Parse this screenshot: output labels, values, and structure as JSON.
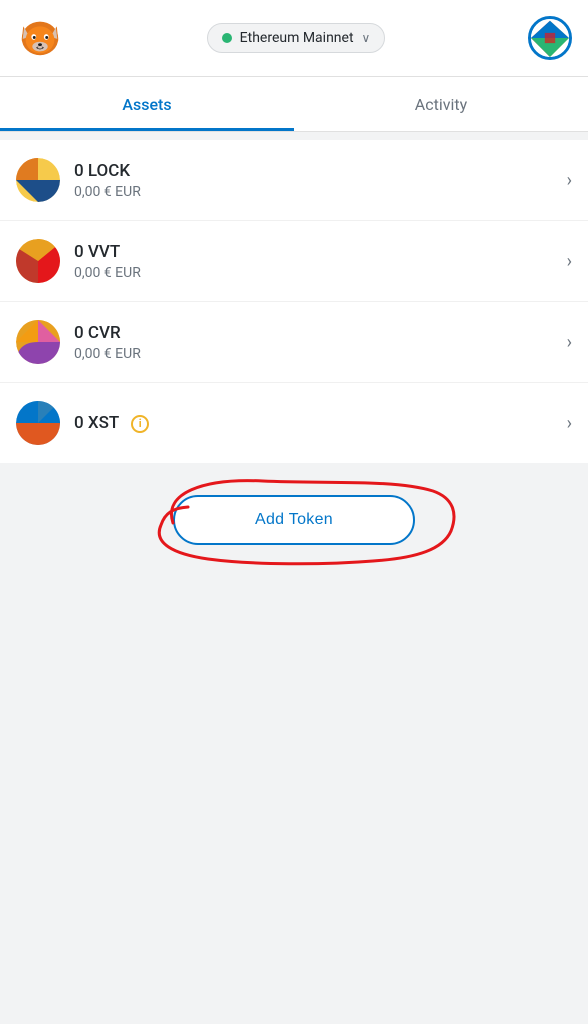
{
  "header": {
    "network_name": "Ethereum Mainnet",
    "network_dot_color": "#29b573"
  },
  "tabs": {
    "assets_label": "Assets",
    "activity_label": "Activity",
    "active": "assets"
  },
  "tokens": [
    {
      "id": "lock",
      "name": "0 LOCK",
      "value": "0,00 € EUR",
      "has_info": false
    },
    {
      "id": "vvt",
      "name": "0 VVT",
      "value": "0,00 € EUR",
      "has_info": false
    },
    {
      "id": "cvr",
      "name": "0 CVR",
      "value": "0,00 € EUR",
      "has_info": false
    },
    {
      "id": "xst",
      "name": "0 XST",
      "value": "",
      "has_info": true
    }
  ],
  "add_token": {
    "label": "Add Token"
  },
  "chevron_right": "›",
  "chevron_down": "∨"
}
